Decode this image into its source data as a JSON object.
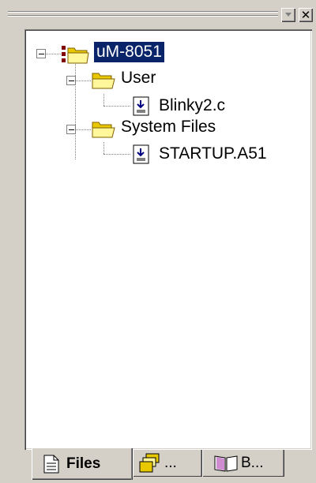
{
  "tree": {
    "root": {
      "label": "uM-8051",
      "icon": "project-folder-icon",
      "selected": true
    },
    "groups": [
      {
        "label": "User",
        "icon": "folder-icon",
        "files": [
          {
            "label": "Blinky2.c",
            "icon": "source-file-icon"
          }
        ]
      },
      {
        "label": "System Files",
        "icon": "folder-icon",
        "files": [
          {
            "label": "STARTUP.A51",
            "icon": "source-file-icon"
          }
        ]
      }
    ]
  },
  "tabs": [
    {
      "label": "Files",
      "icon": "files-tab-icon",
      "active": true
    },
    {
      "label": "...",
      "icon": "regs-tab-icon",
      "active": false
    },
    {
      "label": "B...",
      "icon": "books-tab-icon",
      "active": false
    }
  ],
  "colors": {
    "face": "#d4d0c8",
    "selection": "#0a246a"
  }
}
